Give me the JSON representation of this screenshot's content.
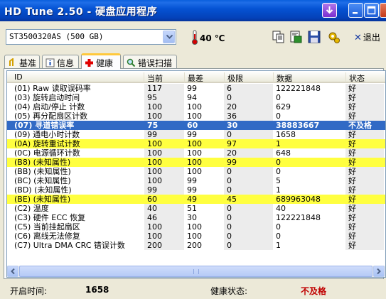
{
  "window": {
    "title": "HD Tune 2.50 - 硬盘应用程序"
  },
  "toolbar": {
    "drive": "ST3500320AS (500 GB)",
    "temperature": "40 ℃",
    "exit_label": "退出"
  },
  "tabs": [
    {
      "label": "基准",
      "icon": "benchmark-icon"
    },
    {
      "label": "信息",
      "icon": "info-icon"
    },
    {
      "label": "健康",
      "icon": "health-cross-icon",
      "active": true
    },
    {
      "label": "错误扫描",
      "icon": "magnifier-icon"
    }
  ],
  "columns": [
    "ID",
    "当前",
    "最差",
    "极限",
    "数据",
    "状态"
  ],
  "rows": [
    {
      "id": "(01) Raw 读取误码率",
      "cur": "117",
      "worst": "99",
      "thr": "6",
      "data": "122221848",
      "status": "好",
      "hl": ""
    },
    {
      "id": "(03) 旋转启动时间",
      "cur": "95",
      "worst": "94",
      "thr": "0",
      "data": "0",
      "status": "好",
      "hl": ""
    },
    {
      "id": "(04) 启动/停止 计数",
      "cur": "100",
      "worst": "100",
      "thr": "20",
      "data": "629",
      "status": "好",
      "hl": ""
    },
    {
      "id": "(05) 再分配扇区计数",
      "cur": "100",
      "worst": "100",
      "thr": "36",
      "data": "0",
      "status": "好",
      "hl": ""
    },
    {
      "id": "(07) 寻道错误率",
      "cur": "75",
      "worst": "60",
      "thr": "30",
      "data": "38883667",
      "status": "不及格",
      "hl": "bad"
    },
    {
      "id": "(09) 通电小时计数",
      "cur": "99",
      "worst": "99",
      "thr": "0",
      "data": "1658",
      "status": "好",
      "hl": ""
    },
    {
      "id": "(0A) 旋转重试计数",
      "cur": "100",
      "worst": "100",
      "thr": "97",
      "data": "1",
      "status": "好",
      "hl": "warn"
    },
    {
      "id": "(0C) 电源循环计数",
      "cur": "100",
      "worst": "100",
      "thr": "20",
      "data": "648",
      "status": "好",
      "hl": ""
    },
    {
      "id": "(B8) (未知属性)",
      "cur": "100",
      "worst": "100",
      "thr": "99",
      "data": "0",
      "status": "好",
      "hl": "warn"
    },
    {
      "id": "(BB) (未知属性)",
      "cur": "100",
      "worst": "100",
      "thr": "0",
      "data": "0",
      "status": "好",
      "hl": ""
    },
    {
      "id": "(BC) (未知属性)",
      "cur": "100",
      "worst": "99",
      "thr": "0",
      "data": "5",
      "status": "好",
      "hl": ""
    },
    {
      "id": "(BD) (未知属性)",
      "cur": "99",
      "worst": "99",
      "thr": "0",
      "data": "1",
      "status": "好",
      "hl": ""
    },
    {
      "id": "(BE) (未知属性)",
      "cur": "60",
      "worst": "49",
      "thr": "45",
      "data": "689963048",
      "status": "好",
      "hl": "warn"
    },
    {
      "id": "(C2) 温度",
      "cur": "40",
      "worst": "51",
      "thr": "0",
      "data": "40",
      "status": "好",
      "hl": ""
    },
    {
      "id": "(C3) 硬件 ECC 恢复",
      "cur": "46",
      "worst": "30",
      "thr": "0",
      "data": "122221848",
      "status": "好",
      "hl": ""
    },
    {
      "id": "(C5) 当前挂起扇区",
      "cur": "100",
      "worst": "100",
      "thr": "0",
      "data": "0",
      "status": "好",
      "hl": ""
    },
    {
      "id": "(C6) 离线无法修复",
      "cur": "100",
      "worst": "100",
      "thr": "0",
      "data": "0",
      "status": "好",
      "hl": ""
    },
    {
      "id": "(C7) Ultra DMA CRC 错误计数",
      "cur": "200",
      "worst": "200",
      "thr": "0",
      "data": "1",
      "status": "好",
      "hl": ""
    }
  ],
  "statusbar": {
    "uptime_label": "开启时间:",
    "uptime_value": "1658",
    "health_label": "健康状态:",
    "health_value": "不及格"
  },
  "colors": {
    "fail_row": "#316ac5",
    "warn_row": "#ffff40",
    "fail_text": "#c00000"
  }
}
